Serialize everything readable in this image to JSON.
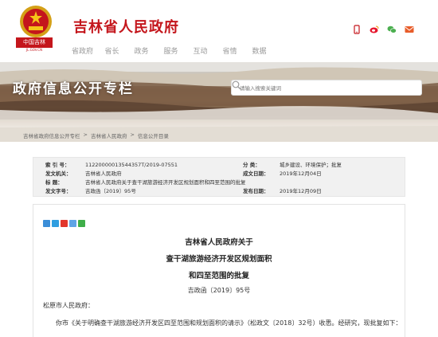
{
  "header": {
    "site_title": "吉林省人民政府",
    "logo_label": "中国吉林",
    "logo_sub": "JL.GOV.CN",
    "nav": [
      "省政府",
      "省长",
      "政务",
      "服务",
      "互动",
      "省情",
      "数据"
    ],
    "colors": {
      "brand_red": "#c4161c"
    }
  },
  "banner": {
    "title": "政府信息公开专栏",
    "search_placeholder": "请输入搜索关键词"
  },
  "breadcrumb": [
    "吉林省政府信息公开专栏",
    "吉林省人民政府",
    "信息公开目录"
  ],
  "breadcrumb_sep": ">",
  "info": {
    "index_label": "索  引  号：",
    "index_value": "11220000013544357T/2019-07551",
    "category_label": "分       类：",
    "category_value": "城乡建设、环境保护；批复",
    "issuer_label": "发文机关：",
    "issuer_value": "吉林省人民政府",
    "written_label": "成文日期：",
    "written_value": "2019年12月04日",
    "title_label": "标       题：",
    "title_value": "吉林省人民政府关于查干湖旅游经济开发区规划面积和四至范围的批复",
    "docno_label": "发文字号：",
    "docno_value": "吉政函〔2019〕95号",
    "published_label": "发布日期：",
    "published_value": "2019年12月09日"
  },
  "article": {
    "title_lines": [
      "吉林省人民政府关于",
      "查干湖旅游经济开发区规划面积",
      "和四至范围的批复"
    ],
    "doc_no": "吉政函〔2019〕95号",
    "addressee": "松原市人民政府：",
    "body": "你市《关于明确查干湖旅游经济开发区四至范围和规划面积的请示》（松政文〔2018〕32号）收悉。经研究，现批复如下："
  }
}
